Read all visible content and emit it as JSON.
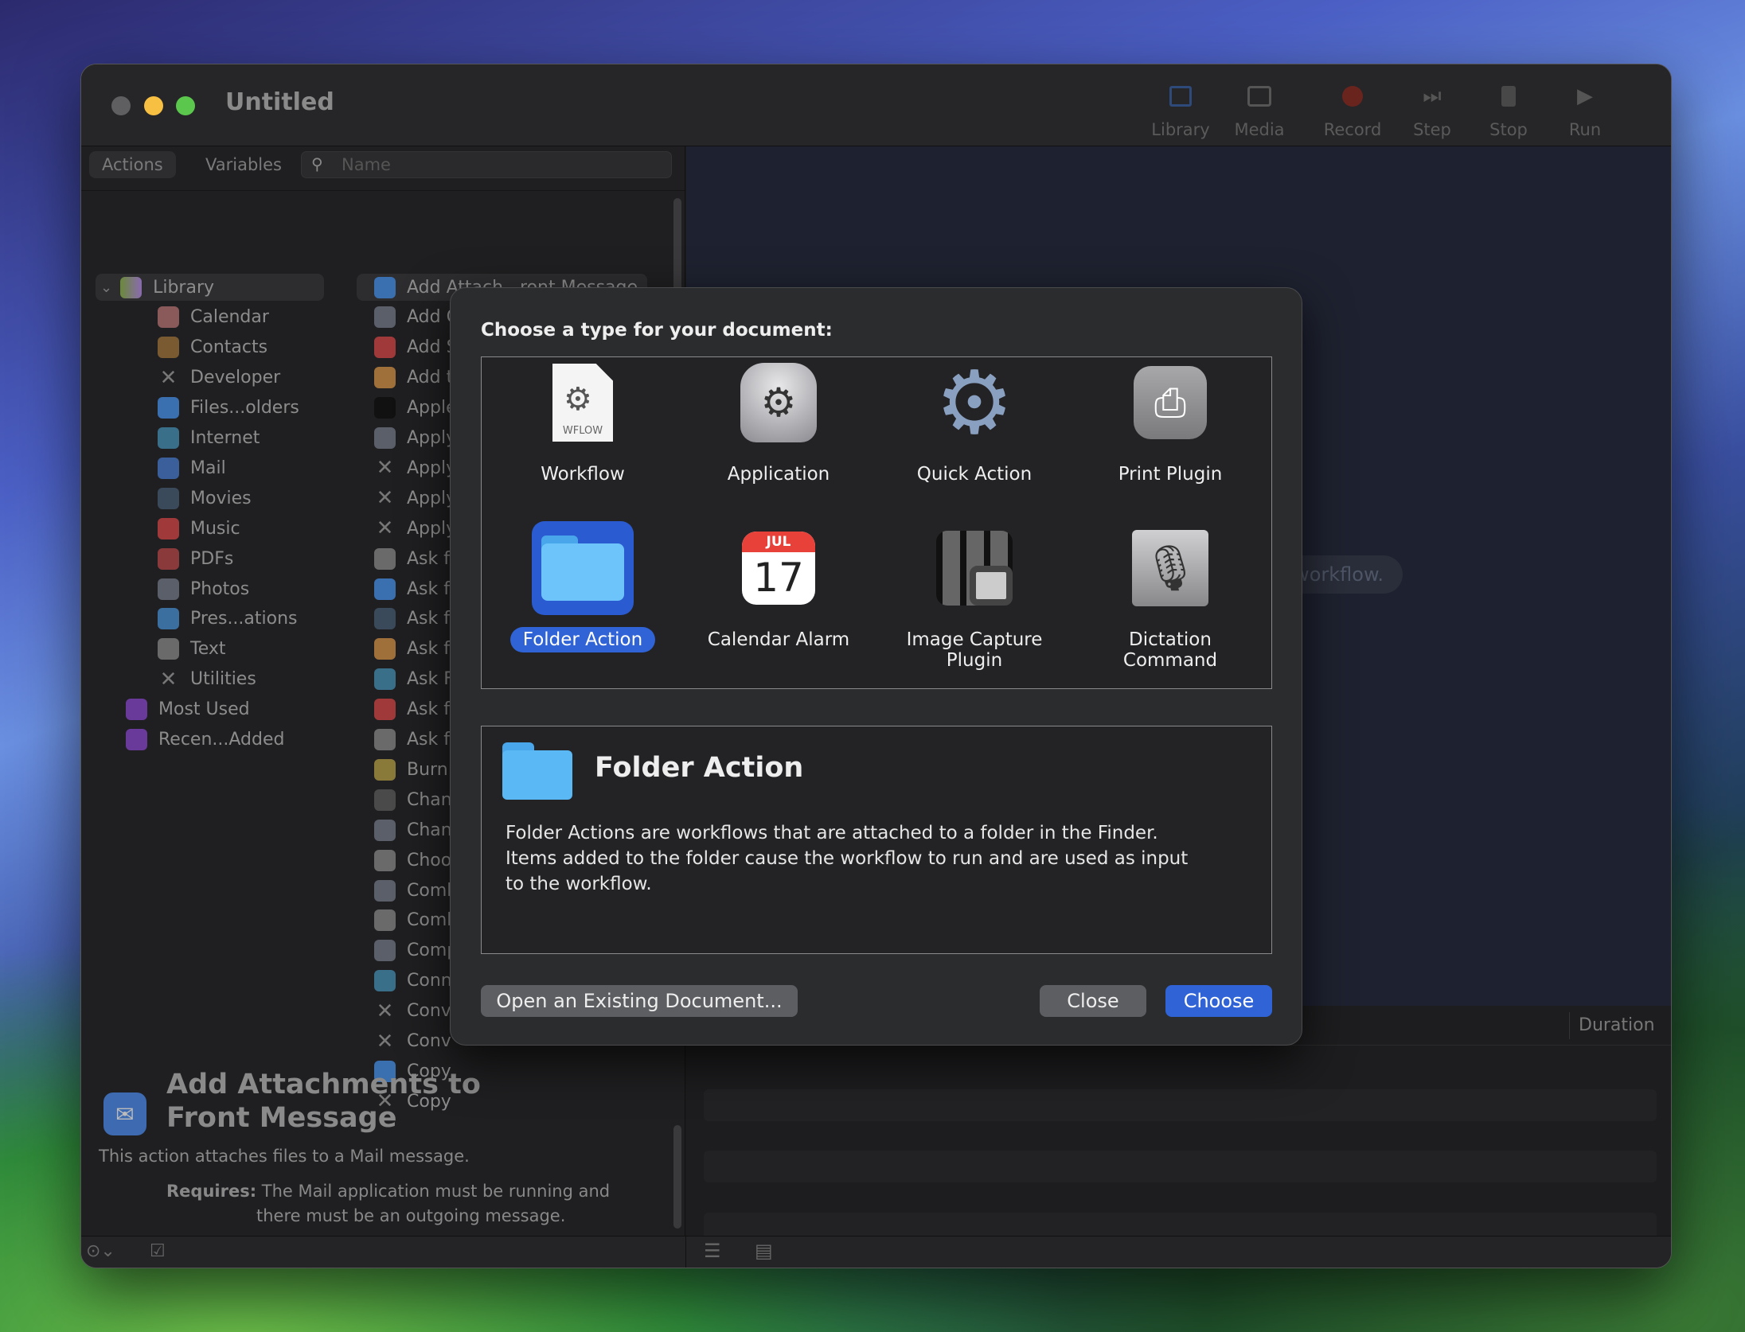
{
  "window": {
    "title": "Untitled",
    "traffic_lights": [
      "#5f5f61",
      "#f7c043",
      "#5bc84d"
    ]
  },
  "toolbar": [
    {
      "label": "Library",
      "icon": "library-icon"
    },
    {
      "label": "Media",
      "icon": "media-icon"
    },
    {
      "label": "Record",
      "icon": "record-icon"
    },
    {
      "label": "Step",
      "icon": "step-icon"
    },
    {
      "label": "Stop",
      "icon": "stop-icon"
    },
    {
      "label": "Run",
      "icon": "run-icon"
    }
  ],
  "left_tabs": {
    "actions": "Actions",
    "variables": "Variables",
    "search_placeholder": "Name"
  },
  "library": {
    "root": "Library",
    "items": [
      {
        "label": "Calendar",
        "color": "#8a5a5a"
      },
      {
        "label": "Contacts",
        "color": "#7a5a30"
      },
      {
        "label": "Developer",
        "color": "x"
      },
      {
        "label": "Files...olders",
        "color": "#3a6fb0"
      },
      {
        "label": "Internet",
        "color": "#3a6f8a"
      },
      {
        "label": "Mail",
        "color": "#3a5f9a"
      },
      {
        "label": "Movies",
        "color": "#3a4a5a"
      },
      {
        "label": "Music",
        "color": "#a03a3a"
      },
      {
        "label": "PDFs",
        "color": "#8a3a3a"
      },
      {
        "label": "Photos",
        "color": "#5a5f6a"
      },
      {
        "label": "Pres...ations",
        "color": "#3a6fa0"
      },
      {
        "label": "Text",
        "color": "#6a6a6a"
      },
      {
        "label": "Utilities",
        "color": "x"
      }
    ],
    "smart": [
      "Most Used",
      "Recen...Added"
    ]
  },
  "actions": [
    {
      "label": "Add Attach...ront Message",
      "color": "#3a6fb0"
    },
    {
      "label": "Add Grid to...F Documents",
      "color": "#5a5f6a"
    },
    {
      "label": "Add Songs to Playlist",
      "color": "#a03a3a"
    },
    {
      "label": "Add t",
      "color": "#a0703a"
    },
    {
      "label": "Apple",
      "color": "#111"
    },
    {
      "label": "Apply",
      "color": "#5a5f6a"
    },
    {
      "label": "Apply",
      "color": "x"
    },
    {
      "label": "Apply",
      "color": "x"
    },
    {
      "label": "Apply",
      "color": "x"
    },
    {
      "label": "Ask fo",
      "color": "#6a6a6a"
    },
    {
      "label": "Ask fo",
      "color": "#3a6fb0"
    },
    {
      "label": "Ask fo",
      "color": "#3a4a5a"
    },
    {
      "label": "Ask fo",
      "color": "#a0703a"
    },
    {
      "label": "Ask F",
      "color": "#3a6f8a"
    },
    {
      "label": "Ask fo",
      "color": "#a03a3a"
    },
    {
      "label": "Ask fo",
      "color": "#6a6a6a"
    },
    {
      "label": "Burn",
      "color": "#8a7a3a"
    },
    {
      "label": "Chan",
      "color": "#4a4a4a"
    },
    {
      "label": "Chan",
      "color": "#5a5f6a"
    },
    {
      "label": "Choo",
      "color": "#6a6a6a"
    },
    {
      "label": "Comb",
      "color": "#5a5f6a"
    },
    {
      "label": "Comb",
      "color": "#6a6a6a"
    },
    {
      "label": "Comp",
      "color": "#5a5f6a"
    },
    {
      "label": "Conn",
      "color": "#3a6f8a"
    },
    {
      "label": "Conv",
      "color": "x"
    },
    {
      "label": "Conv",
      "color": "x"
    },
    {
      "label": "Copy",
      "color": "#3a6fb0"
    },
    {
      "label": "Copy",
      "color": "x"
    }
  ],
  "action_description": {
    "title_line1": "Add Attachments to",
    "title_line2": "Front Message",
    "text": "This action attaches files to a Mail message.",
    "requires_label": "Requires:",
    "requires_line1": "The Mail application must be running and",
    "requires_line2": "there must be an outgoing message."
  },
  "workflow_area": {
    "hint": "r workflow.",
    "log_column": "Duration"
  },
  "dialog": {
    "heading": "Choose a type for your document:",
    "types": [
      {
        "label": "Workflow",
        "icon": "workflow-icon",
        "badge": "WFLOW"
      },
      {
        "label": "Application",
        "icon": "automator-robot-icon"
      },
      {
        "label": "Quick Action",
        "icon": "gear-icon"
      },
      {
        "label": "Print Plugin",
        "icon": "printer-icon"
      },
      {
        "label": "Folder Action",
        "icon": "folder-icon",
        "selected": true
      },
      {
        "label": "Calendar Alarm",
        "icon": "calendar-icon",
        "month": "JUL",
        "day": "17"
      },
      {
        "label": "Image Capture\nPlugin",
        "icon": "camera-icon",
        "line1": "Image Capture",
        "line2": "Plugin"
      },
      {
        "label": "Dictation\nCommand",
        "icon": "microphone-icon",
        "line1": "Dictation",
        "line2": "Command"
      }
    ],
    "selected_title": "Folder Action",
    "selected_description": [
      "Folder Actions are workflows that are attached to a folder in the Finder.",
      "Items added to the folder cause the workflow to run and are used as input",
      "to the workflow."
    ],
    "open_existing": "Open an Existing Document...",
    "close": "Close",
    "choose": "Choose",
    "accent": "#2f63d6"
  }
}
